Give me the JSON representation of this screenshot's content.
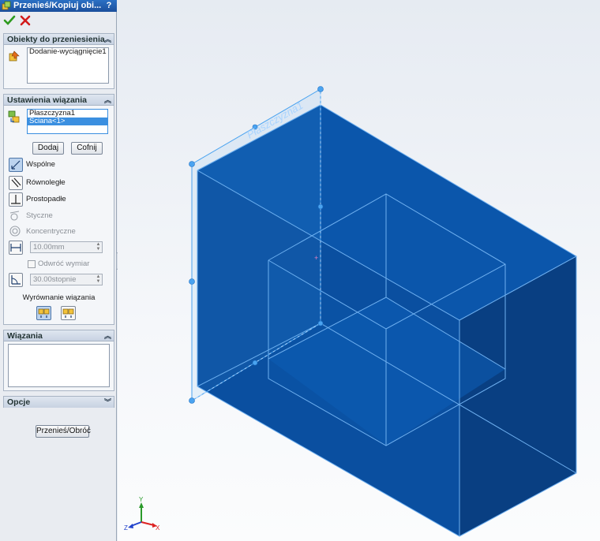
{
  "panel": {
    "title": "Przenieś/Kopiuj obi...",
    "help_label": "?",
    "ok_icon": "check-icon",
    "cancel_icon": "x-icon",
    "sections": {
      "objects": {
        "header": "Obiekty do przeniesienia",
        "items": [
          "Dodanie-wyciągnięcie1"
        ]
      },
      "constraint_settings": {
        "header": "Ustawienia wiązania",
        "items": [
          "Płaszczyzna1",
          "Ściana<1>"
        ],
        "selected_index": 1,
        "add_label": "Dodaj",
        "undo_label": "Cofnij",
        "mates": [
          {
            "label": "Wspólne",
            "icon": "coincident-icon",
            "active": true,
            "enabled": true
          },
          {
            "label": "Równoległe",
            "icon": "parallel-icon",
            "active": false,
            "enabled": true
          },
          {
            "label": "Prostopadłe",
            "icon": "perpendicular-icon",
            "active": false,
            "enabled": true
          },
          {
            "label": "Styczne",
            "icon": "tangent-icon",
            "active": false,
            "enabled": false
          },
          {
            "label": "Koncentryczne",
            "icon": "concentric-icon",
            "active": false,
            "enabled": false
          }
        ],
        "distance_value": "10.00mm",
        "flip_dimension_label": "Odwróć wymiar",
        "angle_value": "30.00stopnie",
        "alignment_label": "Wyrównanie wiązania"
      },
      "constraints": {
        "header": "Wiązania",
        "items": []
      },
      "options": {
        "header": "Opcje",
        "move_rotate_label": "Przenieś/Obróć"
      }
    }
  },
  "viewport": {
    "plane_label": "Płaszczyzna1",
    "triad_labels": {
      "x": "X",
      "y": "Y",
      "z": "Z"
    },
    "colors": {
      "body_blue": "#0a4fa0",
      "edge_light": "#6fb0f0",
      "plane_outline": "#4aa3f0"
    }
  }
}
